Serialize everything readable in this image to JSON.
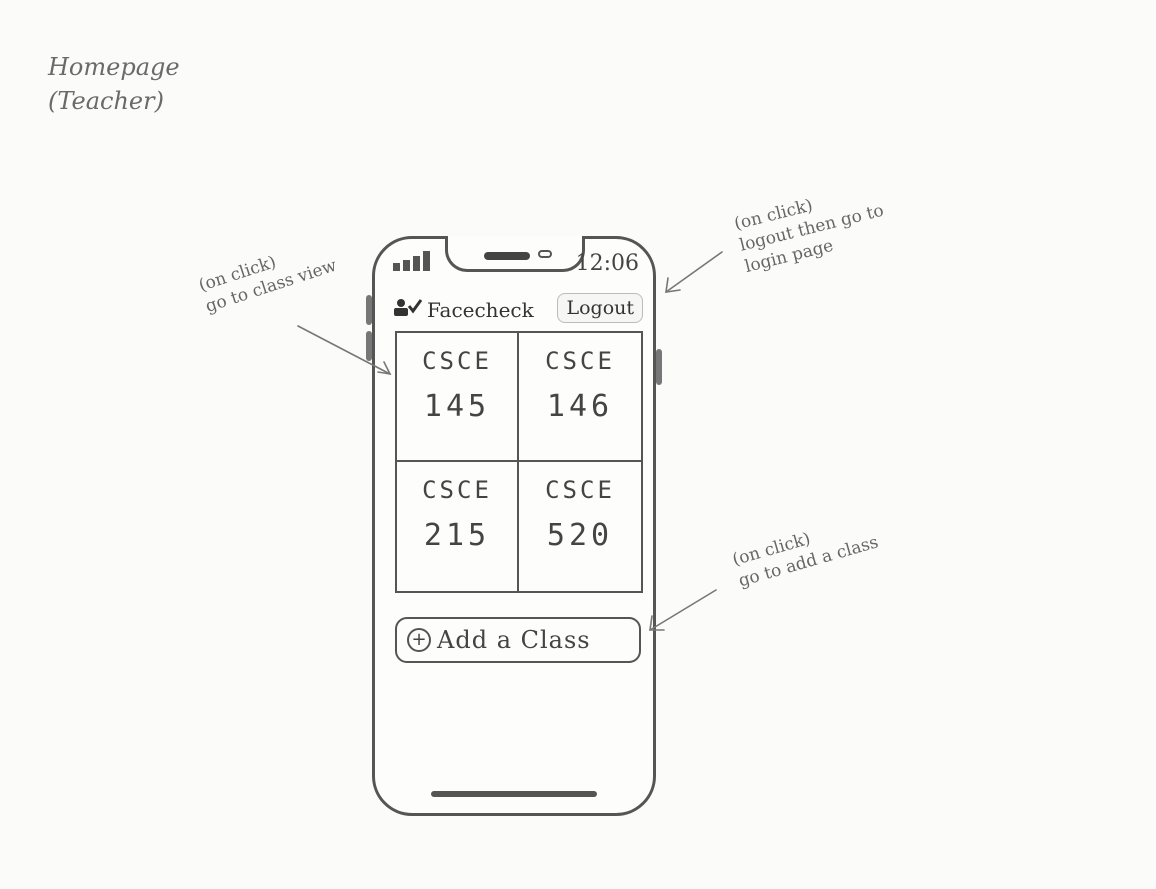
{
  "page_title": {
    "line1": "Homepage",
    "line2": "(Teacher)"
  },
  "status_bar": {
    "time": "12:06"
  },
  "header": {
    "app_name": "Facecheck",
    "brand_icon": "user-check-icon",
    "logout_label": "Logout"
  },
  "classes": [
    {
      "dept": "CSCE",
      "number": "145"
    },
    {
      "dept": "CSCE",
      "number": "146"
    },
    {
      "dept": "CSCE",
      "number": "215"
    },
    {
      "dept": "CSCE",
      "number": "520"
    }
  ],
  "add_class": {
    "icon": "plus-circle-icon",
    "label": "Add a Class"
  },
  "annotations": {
    "classview": [
      "(on click)",
      "go to class view"
    ],
    "logout": [
      "(on click)",
      "logout then go to",
      "login page"
    ],
    "add": [
      "(on click)",
      "go to add a class"
    ]
  },
  "colors": {
    "pencil": "#555555",
    "paper": "#fbfbf9"
  }
}
